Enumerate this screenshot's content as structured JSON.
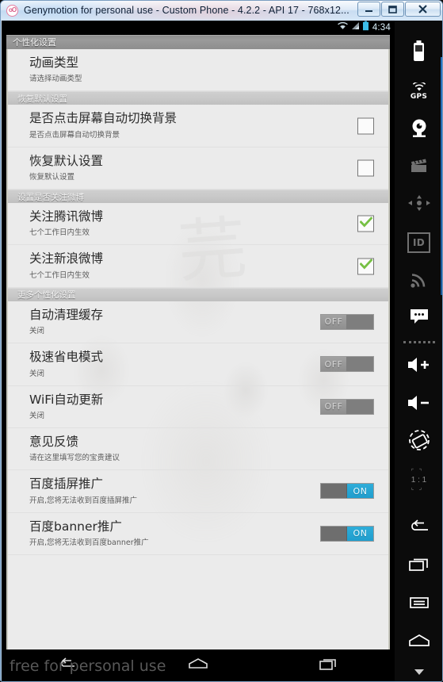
{
  "window": {
    "title": "Genymotion for personal use - Custom Phone - 4.2.2 - API 17 - 768x12...",
    "app_icon": "oO",
    "minimize_label": "Minimize",
    "maximize_label": "Maximize",
    "close_label": "Close"
  },
  "status_bar": {
    "time": "4:34",
    "wifi_icon": "wifi-icon",
    "signal_icon": "signal-icon",
    "battery_icon": "battery-icon"
  },
  "app": {
    "title": "个性化设置"
  },
  "sections": [
    {
      "header": null,
      "rows": [
        {
          "title": "动画类型",
          "summary": "请选择动画类型",
          "widget": "none"
        }
      ]
    },
    {
      "header": "恢复默认设置",
      "rows": [
        {
          "title": "是否点击屏幕自动切换背景",
          "summary": "是否点击屏幕自动切换背景",
          "widget": "checkbox",
          "checked": false
        },
        {
          "title": "恢复默认设置",
          "summary": "恢复默认设置",
          "widget": "checkbox",
          "checked": false
        }
      ]
    },
    {
      "header": "设置是否关注微博",
      "rows": [
        {
          "title": "关注腾讯微博",
          "summary": "七个工作日内生效",
          "widget": "checkbox",
          "checked": true
        },
        {
          "title": "关注新浪微博",
          "summary": "七个工作日内生效",
          "widget": "checkbox",
          "checked": true
        }
      ]
    },
    {
      "header": "更多个性化设置",
      "rows": [
        {
          "title": "自动清理缓存",
          "summary": "关闭",
          "widget": "switch",
          "switch_state": "OFF"
        },
        {
          "title": "极速省电模式",
          "summary": "关闭",
          "widget": "switch",
          "switch_state": "OFF"
        },
        {
          "title": "WiFi自动更新",
          "summary": "关闭",
          "widget": "switch",
          "switch_state": "OFF"
        },
        {
          "title": "意见反馈",
          "summary": "请在这里填写您的宝贵建议",
          "widget": "none"
        },
        {
          "title": "百度插屏推广",
          "summary": "开启,您将无法收到百度插屏推广",
          "widget": "switch",
          "switch_state": "ON"
        },
        {
          "title": "百度banner推广",
          "summary": "开启,您将无法收到百度banner推广",
          "widget": "switch",
          "switch_state": "ON"
        }
      ]
    }
  ],
  "switch_labels": {
    "on": "ON",
    "off": "OFF"
  },
  "nav_bar": {
    "watermark": "free for personal use",
    "back": "back-button",
    "home": "home-button",
    "recents": "recents-button"
  },
  "toolbar": {
    "items": [
      {
        "name": "battery-icon",
        "label": ""
      },
      {
        "name": "gps-icon",
        "label": "GPS"
      },
      {
        "name": "camera-icon",
        "label": ""
      },
      {
        "name": "video-recorder-icon",
        "label": ""
      },
      {
        "name": "dpad-icon",
        "label": ""
      },
      {
        "name": "identifiers-icon",
        "label": "ID"
      },
      {
        "name": "network-icon",
        "label": ""
      },
      {
        "name": "sms-icon",
        "label": ""
      },
      {
        "name": "volume-up-icon",
        "label": ""
      },
      {
        "name": "volume-down-icon",
        "label": ""
      },
      {
        "name": "rotate-screen-icon",
        "label": ""
      },
      {
        "name": "screen-ratio-icon",
        "label": "1 : 1"
      },
      {
        "name": "back-icon",
        "label": ""
      },
      {
        "name": "recents-icon",
        "label": ""
      },
      {
        "name": "menu-icon",
        "label": ""
      },
      {
        "name": "home-icon",
        "label": ""
      },
      {
        "name": "more-icon",
        "label": ""
      }
    ]
  },
  "colors": {
    "accent_blue": "#2fadd9",
    "check_green": "#76c043",
    "window_chrome": "#b8d2ea",
    "list_bg": "#ebebeb",
    "section_header": "#c8c8c8"
  }
}
